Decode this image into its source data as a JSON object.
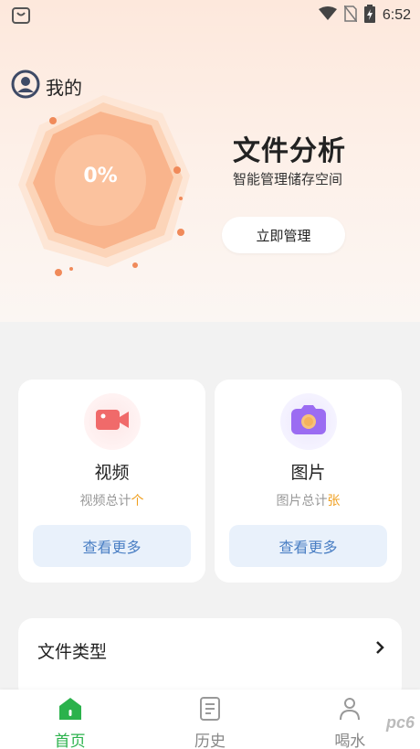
{
  "status_bar": {
    "time": "6:52"
  },
  "header": {
    "user_label": "我的"
  },
  "analysis": {
    "percent": "0%",
    "title": "文件分析",
    "subtitle": "智能管理储存空间",
    "manage_button": "立即管理"
  },
  "cards": [
    {
      "title": "视频",
      "count_prefix": "视频总计",
      "count_unit": "个",
      "button": "查看更多",
      "icon": "video-camera-icon",
      "accent": "#f06a6a"
    },
    {
      "title": "图片",
      "count_prefix": "图片总计",
      "count_unit": "张",
      "button": "查看更多",
      "icon": "camera-icon",
      "accent": "#9b6cf2"
    }
  ],
  "file_types": {
    "label": "文件类型"
  },
  "tabs": [
    {
      "label": "首页",
      "icon": "home-icon",
      "active": true
    },
    {
      "label": "历史",
      "icon": "history-icon",
      "active": false
    },
    {
      "label": "喝水",
      "icon": "person-icon",
      "active": false
    }
  ],
  "watermark": "pc6",
  "colors": {
    "accent_green": "#2bb24c",
    "button_blue": "#4a7fc4",
    "orange": "#f0a020"
  }
}
